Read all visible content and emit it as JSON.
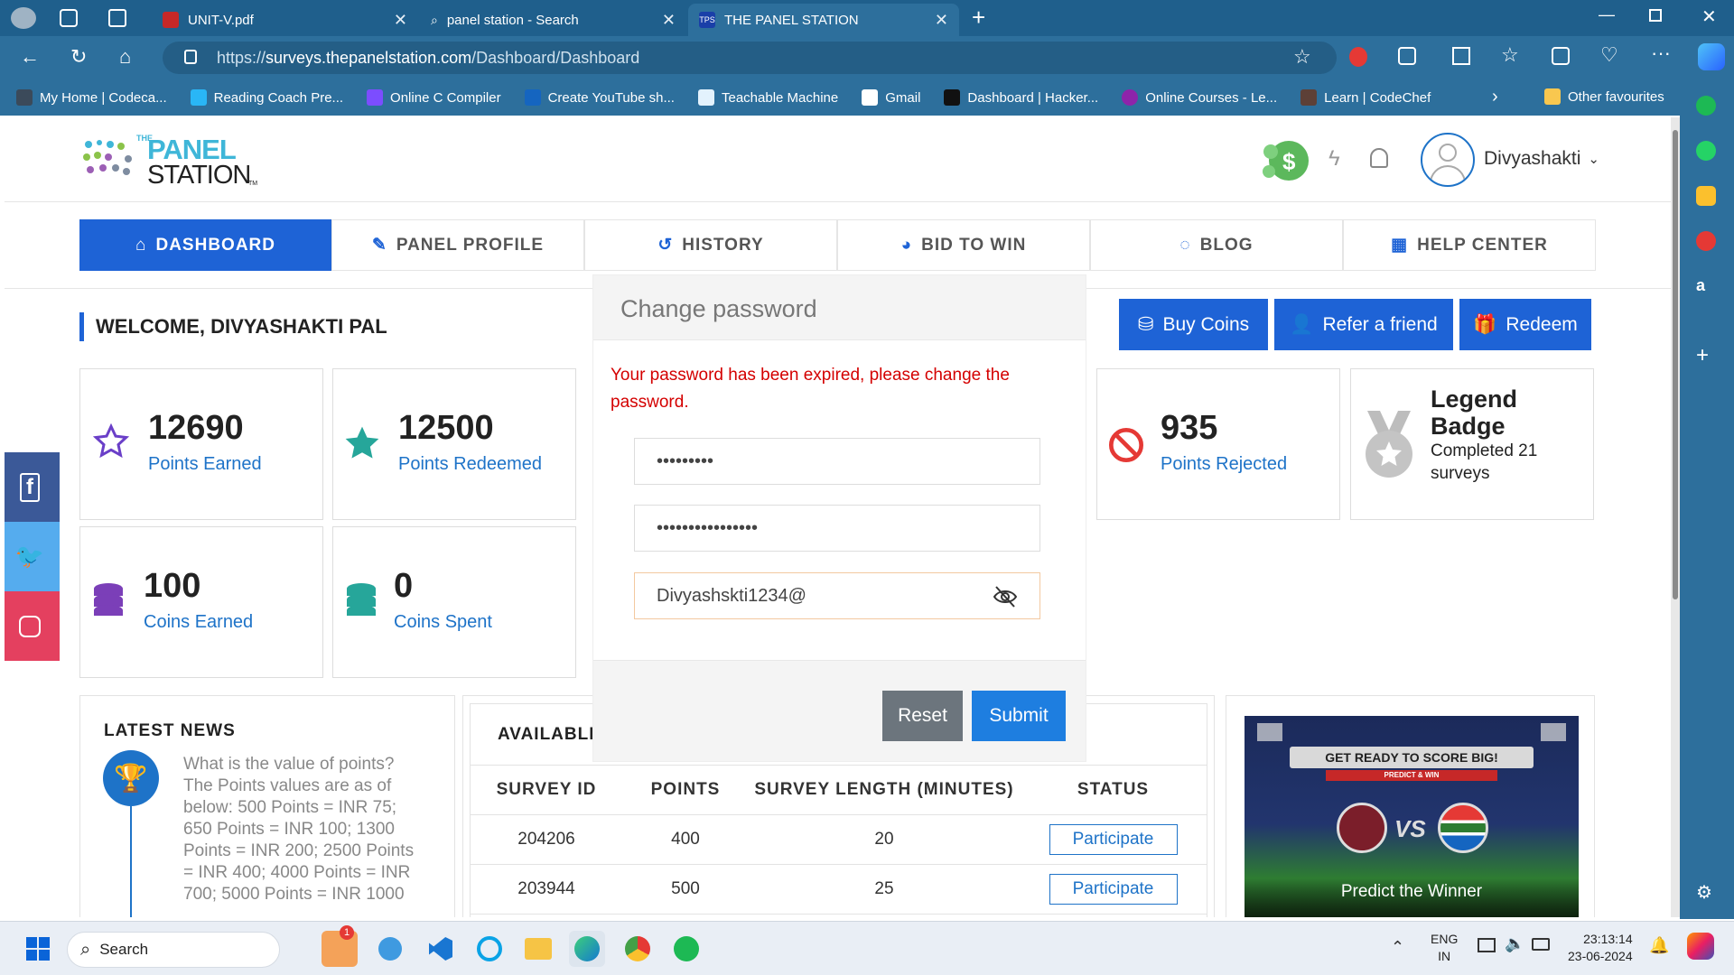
{
  "browser": {
    "tabs": [
      {
        "title": "UNIT-V.pdf",
        "favicon": "pdf-icon"
      },
      {
        "title": "panel station - Search",
        "favicon": "search-icon"
      },
      {
        "title": "THE PANEL STATION",
        "favicon": "tps-icon",
        "active": true
      }
    ],
    "url_prefix": "https://",
    "url_domain": "surveys.thepanelstation.com",
    "url_path": "/Dashboard/Dashboard",
    "favorites": [
      "My Home | Codeca...",
      "Reading Coach Pre...",
      "Online C Compiler",
      "Create YouTube sh...",
      "Teachable Machine",
      "Gmail",
      "Dashboard | Hacker...",
      "Online Courses - Le...",
      "Learn | CodeChef"
    ],
    "other_favourites": "Other favourites"
  },
  "site": {
    "logo_the": "THE",
    "logo_panel": "PANEL",
    "logo_station": "STATION",
    "logo_tm": "TM",
    "username": "Divyashakti"
  },
  "nav": [
    {
      "label": "DASHBOARD",
      "icon": "home-icon"
    },
    {
      "label": "PANEL PROFILE",
      "icon": "edit-icon"
    },
    {
      "label": "HISTORY",
      "icon": "history-icon"
    },
    {
      "label": "BID TO WIN",
      "icon": "bid-icon"
    },
    {
      "label": "BLOG",
      "icon": "blog-icon"
    },
    {
      "label": "HELP CENTER",
      "icon": "help-icon"
    }
  ],
  "welcome": "WELCOME, DIVYASHAKTI PAL",
  "actions": {
    "buy": "Buy Coins",
    "refer": "Refer a friend",
    "redeem": "Redeem"
  },
  "stats": {
    "earned": {
      "value": "12690",
      "label": "Points Earned"
    },
    "redeemed": {
      "value": "12500",
      "label": "Points Redeemed"
    },
    "rejected": {
      "value": "935",
      "label": "Points Rejected"
    },
    "badge_title": "Legend Badge",
    "badge_sub": "Completed 21 surveys",
    "coins_earned": {
      "value": "100",
      "label": "Coins Earned"
    },
    "coins_spent": {
      "value": "0",
      "label": "Coins Spent"
    }
  },
  "news": {
    "title": "LATEST NEWS",
    "text": "What is the value of points? The Points values are as of below: 500 Points = INR 75; 650 Points = INR 100; 1300 Points = INR 200; 2500 Points = INR 400; 4000 Points = INR 700; 5000 Points = INR 1000"
  },
  "surveys": {
    "title": "AVAILABLE",
    "headers": [
      "SURVEY ID",
      "POINTS",
      "SURVEY LENGTH (MINUTES)",
      "STATUS"
    ],
    "rows": [
      {
        "id": "204206",
        "points": "400",
        "length": "20",
        "status": "Participate"
      },
      {
        "id": "203944",
        "points": "500",
        "length": "25",
        "status": "Participate"
      }
    ]
  },
  "promo": {
    "headline": "GET READY TO SCORE BIG!",
    "sub": "PREDICT & WIN",
    "vs": "VS",
    "caption": "Predict the Winner"
  },
  "modal": {
    "title": "Change password",
    "error": "Your password has been expired, please change the password.",
    "field1": "•••••••••",
    "field2": "••••••••••••••••",
    "field3": "Divyashskti1234@",
    "reset": "Reset",
    "submit": "Submit"
  },
  "taskbar": {
    "search": "Search",
    "lang1": "ENG",
    "lang2": "IN",
    "time": "23:13:14",
    "date": "23-06-2024",
    "badge": "1"
  }
}
